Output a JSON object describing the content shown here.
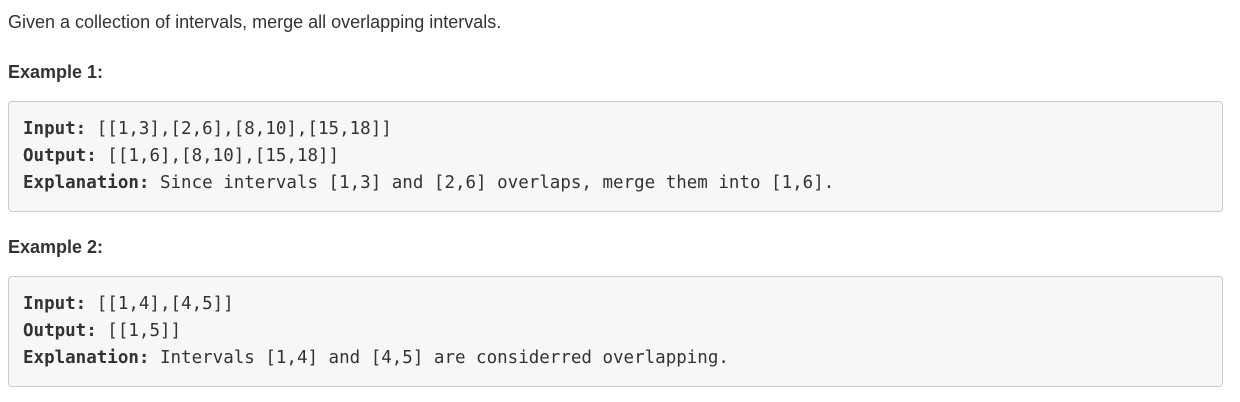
{
  "intro": "Given a collection of intervals, merge all overlapping intervals.",
  "examples": [
    {
      "heading": "Example 1:",
      "lines": [
        {
          "key": "Input:",
          "value": " [[1,3],[2,6],[8,10],[15,18]]"
        },
        {
          "key": "Output:",
          "value": " [[1,6],[8,10],[15,18]]"
        },
        {
          "key": "Explanation:",
          "value": " Since intervals [1,3] and [2,6] overlaps, merge them into [1,6]."
        }
      ]
    },
    {
      "heading": "Example 2:",
      "lines": [
        {
          "key": "Input:",
          "value": " [[1,4],[4,5]]"
        },
        {
          "key": "Output:",
          "value": " [[1,5]]"
        },
        {
          "key": "Explanation:",
          "value": " Intervals [1,4] and [4,5] are considerred overlapping."
        }
      ]
    }
  ]
}
